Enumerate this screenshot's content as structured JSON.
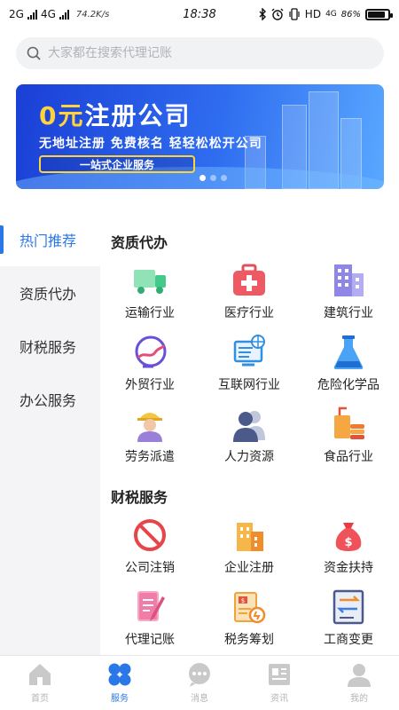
{
  "status_bar": {
    "net1": "2G",
    "net2": "4G",
    "speed": "74.2K/s",
    "time": "18:38",
    "right_text": "HD",
    "net3": "4G",
    "battery": "86%",
    "battery_level": 0.86
  },
  "search": {
    "placeholder": "大家都在搜索代理记账"
  },
  "banner": {
    "title_num": "0元",
    "title_rest": "注册公司",
    "subtitle": "无地址注册  免费核名  轻轻松松开公司",
    "tag": "一站式企业服务",
    "dots": 3,
    "active_dot": 0
  },
  "sidebar": {
    "items": [
      {
        "label": "热门推荐",
        "active": true
      },
      {
        "label": "资质代办",
        "active": false
      },
      {
        "label": "财税服务",
        "active": false
      },
      {
        "label": "办公服务",
        "active": false
      }
    ]
  },
  "sections": [
    {
      "title": "资质代办",
      "items": [
        {
          "label": "运输行业",
          "icon": "truck-icon"
        },
        {
          "label": "医疗行业",
          "icon": "medical-kit-icon"
        },
        {
          "label": "建筑行业",
          "icon": "building-icon"
        },
        {
          "label": "外贸行业",
          "icon": "globe-icon"
        },
        {
          "label": "互联网行业",
          "icon": "computer-globe-icon"
        },
        {
          "label": "危险化学品",
          "icon": "flask-icon"
        },
        {
          "label": "劳务派遣",
          "icon": "worker-icon"
        },
        {
          "label": "人力资源",
          "icon": "people-icon"
        },
        {
          "label": "食品行业",
          "icon": "food-icon"
        }
      ]
    },
    {
      "title": "财税服务",
      "items": [
        {
          "label": "公司注销",
          "icon": "cancel-icon"
        },
        {
          "label": "企业注册",
          "icon": "office-building-icon"
        },
        {
          "label": "资金扶持",
          "icon": "money-bag-icon"
        },
        {
          "label": "代理记账",
          "icon": "notebook-icon"
        },
        {
          "label": "税务筹划",
          "icon": "tax-icon"
        },
        {
          "label": "工商变更",
          "icon": "change-icon"
        }
      ]
    }
  ],
  "bottom_nav": [
    {
      "label": "首页",
      "icon": "home-icon",
      "active": false
    },
    {
      "label": "服务",
      "icon": "service-grid-icon",
      "active": true
    },
    {
      "label": "消息",
      "icon": "message-icon",
      "active": false
    },
    {
      "label": "资讯",
      "icon": "news-icon",
      "active": false
    },
    {
      "label": "我的",
      "icon": "profile-icon",
      "active": false
    }
  ],
  "colors": {
    "accent": "#2a78e8",
    "banner_start": "#1a3fd6",
    "banner_end": "#59a8ff",
    "highlight": "#ffd43b"
  }
}
